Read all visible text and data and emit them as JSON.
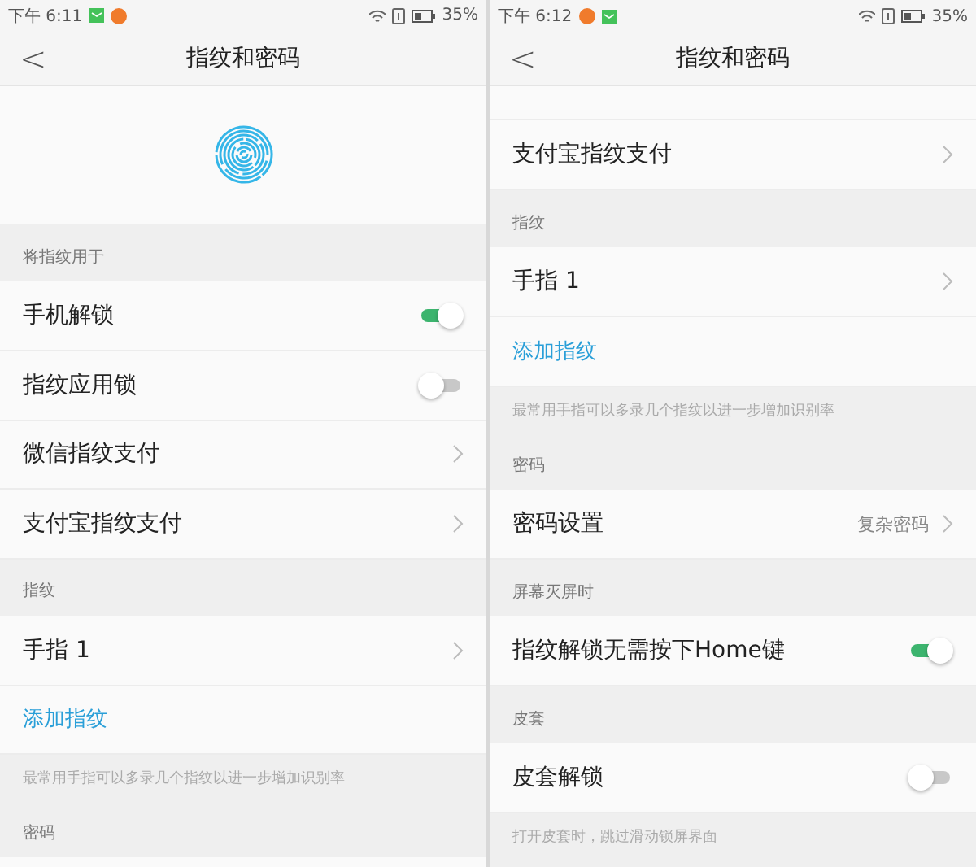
{
  "screens": [
    {
      "status_bar": {
        "time": "下午 6:11",
        "notifications": [
          {
            "kind": "message"
          },
          {
            "kind": "app"
          }
        ],
        "battery": "35%"
      },
      "nav": {
        "back": "<",
        "title": "指纹和密码"
      },
      "items": [
        {
          "kind": "hero"
        },
        {
          "kind": "header",
          "label": "将指纹用于"
        },
        {
          "kind": "toggle",
          "label": "手机解锁",
          "on": true
        },
        {
          "kind": "toggle",
          "label": "指纹应用锁",
          "on": false
        },
        {
          "kind": "chevron",
          "label": "微信指纹支付"
        },
        {
          "kind": "chevron",
          "label": "支付宝指纹支付"
        },
        {
          "kind": "header",
          "label": "指纹"
        },
        {
          "kind": "chevron",
          "label": "手指 1"
        },
        {
          "kind": "link",
          "label": "添加指纹"
        },
        {
          "kind": "note",
          "label": "最常用手指可以多录几个指纹以进一步增加识别率"
        },
        {
          "kind": "header",
          "label": "密码"
        },
        {
          "kind": "stub"
        }
      ]
    },
    {
      "status_bar": {
        "time": "下午 6:12",
        "notifications": [
          {
            "kind": "app"
          },
          {
            "kind": "message"
          }
        ],
        "battery": "35%"
      },
      "nav": {
        "back": "<",
        "title": "指纹和密码"
      },
      "items": [
        {
          "kind": "stub"
        },
        {
          "kind": "chevron",
          "label": "支付宝指纹支付"
        },
        {
          "kind": "header",
          "label": "指纹"
        },
        {
          "kind": "chevron",
          "label": "手指 1"
        },
        {
          "kind": "link",
          "label": "添加指纹"
        },
        {
          "kind": "note",
          "label": "最常用手指可以多录几个指纹以进一步增加识别率"
        },
        {
          "kind": "header",
          "label": "密码"
        },
        {
          "kind": "chevron",
          "label": "密码设置",
          "value": "复杂密码"
        },
        {
          "kind": "header",
          "label": "屏幕灭屏时"
        },
        {
          "kind": "toggle",
          "label": "指纹解锁无需按下Home键",
          "on": true
        },
        {
          "kind": "header",
          "label": "皮套"
        },
        {
          "kind": "toggle",
          "label": "皮套解锁",
          "on": false
        },
        {
          "kind": "note",
          "label": "打开皮套时，跳过滑动锁屏界面"
        }
      ]
    }
  ]
}
